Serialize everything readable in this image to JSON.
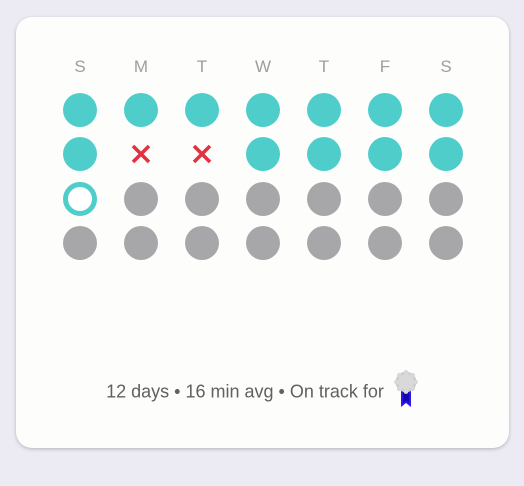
{
  "colors": {
    "done": "#4ECDCA",
    "missed": "#E0333F",
    "future": "#A7A7A9",
    "today_ring": "#4ECDCA",
    "background": "#ECEBF3",
    "card": "#FDFDFC"
  },
  "calendar": {
    "weekdays": [
      "S",
      "M",
      "T",
      "W",
      "T",
      "F",
      "S"
    ],
    "weeks": [
      [
        "done",
        "done",
        "done",
        "done",
        "done",
        "done",
        "done"
      ],
      [
        "done",
        "missed",
        "missed",
        "done",
        "done",
        "done",
        "done"
      ],
      [
        "today",
        "future",
        "future",
        "future",
        "future",
        "future",
        "future"
      ],
      [
        "future",
        "future",
        "future",
        "future",
        "future",
        "future",
        "future"
      ]
    ]
  },
  "footer": {
    "summary": "12 days • 16 min avg • On track for",
    "badge_icon": "award-ribbon-icon"
  }
}
